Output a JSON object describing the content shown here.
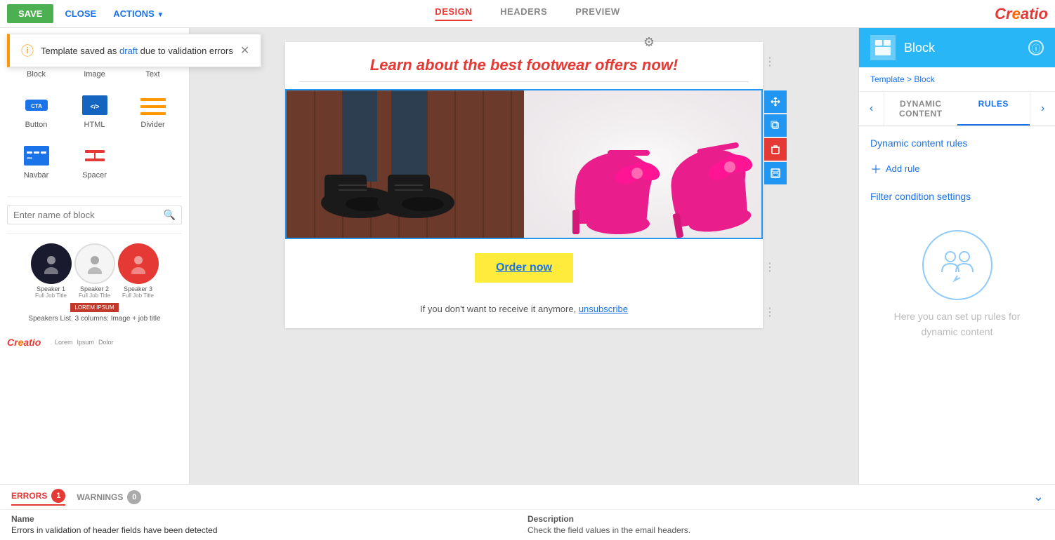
{
  "toolbar": {
    "save_label": "SAVE",
    "close_label": "CLOSE",
    "actions_label": "ACTIONS",
    "tabs": [
      {
        "label": "DESIGN",
        "active": true
      },
      {
        "label": "HEADERS",
        "active": false
      },
      {
        "label": "PREVIEW",
        "active": false
      }
    ],
    "logo": "Creatio"
  },
  "notification": {
    "text": "Template saved as draft due to validation errors",
    "link_text": "draft"
  },
  "sidebar": {
    "items": [
      {
        "label": "Block",
        "icon": "block-icon"
      },
      {
        "label": "Image",
        "icon": "image-icon"
      },
      {
        "label": "Text",
        "icon": "text-icon"
      },
      {
        "label": "Button",
        "icon": "button-icon"
      },
      {
        "label": "HTML",
        "icon": "html-icon"
      },
      {
        "label": "Divider",
        "icon": "divider-icon"
      },
      {
        "label": "Navbar",
        "icon": "navbar-icon"
      },
      {
        "label": "Spacer",
        "icon": "spacer-icon"
      }
    ],
    "search_placeholder": "Enter name of block",
    "speaker_block_label": "Speakers List. 3 columns: Image + job title"
  },
  "canvas": {
    "email_heading": "Learn about the best footwear offers now!",
    "order_button_label": "Order now",
    "unsubscribe_text": "If you don't want to receive it anymore,",
    "unsubscribe_link": "unsubscribe"
  },
  "right_panel": {
    "header_title": "Block",
    "breadcrumb_template": "Template",
    "breadcrumb_block": "Block",
    "tabs": [
      {
        "label": "DYNAMIC CONTENT",
        "active": false
      },
      {
        "label": "RULES",
        "active": true
      }
    ],
    "dynamic_content_rules_label": "Dynamic content rules",
    "add_rule_label": "Add rule",
    "filter_condition_label": "Filter condition settings",
    "empty_state_text": "Here you can set up rules for dynamic content"
  },
  "bottom_bar": {
    "errors_label": "ERRORS",
    "errors_count": "1",
    "warnings_label": "WARNINGS",
    "warnings_count": "0",
    "name_col": "Name",
    "desc_col": "Description",
    "error_name": "Errors in validation of header fields have been detected",
    "error_desc": "Check the field values in the email headers."
  },
  "image_actions": [
    {
      "icon": "move-icon",
      "label": "move"
    },
    {
      "icon": "copy-icon",
      "label": "copy"
    },
    {
      "icon": "delete-icon",
      "label": "delete"
    },
    {
      "icon": "save-block-icon",
      "label": "save-block"
    }
  ]
}
